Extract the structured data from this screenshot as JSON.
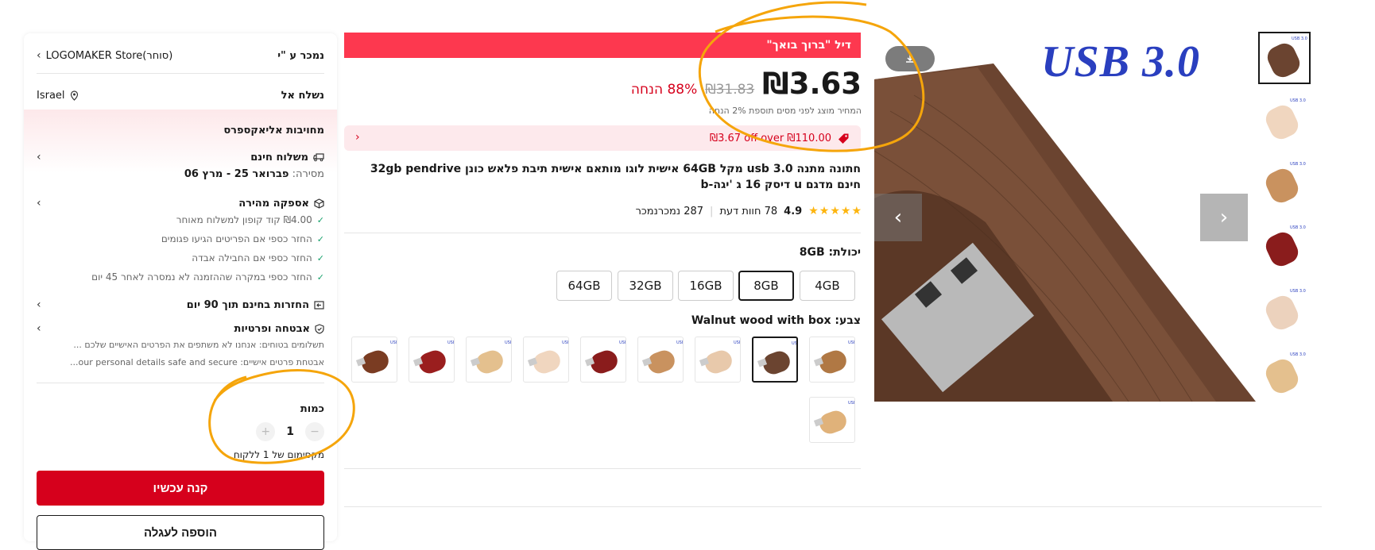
{
  "seller": {
    "label": "נמכר ע \"י",
    "store": "LOGOMAKER Store(סוחר)"
  },
  "ship_to": {
    "label": "נשלח אל",
    "country": "Israel"
  },
  "commitments": {
    "title": "מחויבות אליאקספרס",
    "free_shipping": {
      "title": "משלוח חינם",
      "delivery_label": "מסירה:",
      "delivery_dates": "פברואר 25 - מרץ 06"
    },
    "fast_delivery": {
      "title": "אספקה מהירה",
      "items": [
        "₪4.00 קוד קופון למשלוח מאוחר",
        "החזר כספי אם הפריטים הגיעו פגומים",
        "החזר כספי אם החבילה אבדה",
        "החזר כספי במקרה שההזמנה לא נמסרה לאחר 45 יום"
      ]
    },
    "returns": {
      "title": "החזרות בחינם תוך 90 יום"
    },
    "security": {
      "title": "אבטחה ופרטיות",
      "items": [
        "תשלומים בטוחים: אנחנו לא משתפים את הפרטים האישיים שלכם ...",
        "אבטחת פרטים אישיים: our personal details safe and secure..."
      ]
    }
  },
  "quantity": {
    "label": "כמות",
    "value": "1",
    "minus": "−",
    "plus": "+",
    "max_note": "מקסימום של 1 ללקוח"
  },
  "buttons": {
    "buy_now": "קנה עכשיו",
    "add_to_cart": "הוספה לעגלה"
  },
  "deal": {
    "banner": "דיל \"ברוך בואך\""
  },
  "price": {
    "current": "₪3.63",
    "original": "₪31.83",
    "discount": "88% הנחה",
    "tax_note": "המחיר מוצג לפני מסים תוספת 2% הנחה"
  },
  "coupon": {
    "text": "₪3.67 off over ₪110.00"
  },
  "product": {
    "title": "חתונה מתנה 3.0 usb מקל 64GB אישית לוגו מותאם אישית תיבת פלאש כונן 32gb pendrive חינם מדגם u דיסק 16 ג 'יגה-b"
  },
  "rating": {
    "score": "4.9",
    "reviews": "78 חוות דעת",
    "sold": "287 נמכרנמכר",
    "stars": 5
  },
  "capacity": {
    "label": "יכולת:",
    "selected": "8GB",
    "options": [
      "4GB",
      "8GB",
      "16GB",
      "32GB",
      "64GB"
    ]
  },
  "color": {
    "label": "צבע:",
    "selected": "Walnut wood with box"
  },
  "gallery": {
    "banner_text": "USB 3.0"
  },
  "colors": {
    "accent": "#d6001c",
    "deal": "#fd384f",
    "annotation": "#f5a50b"
  }
}
